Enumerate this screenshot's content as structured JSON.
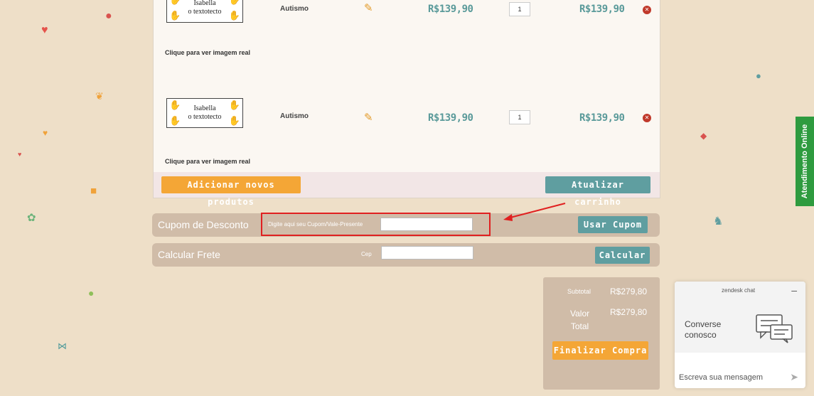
{
  "cart": {
    "items": [
      {
        "thumb_line1": "Isabella",
        "thumb_line2": "o textotecto",
        "caption": "Clique para ver imagem real",
        "name": "Autismo",
        "unit_price": "R$139,90",
        "quantity": "1",
        "total": "R$139,90"
      },
      {
        "thumb_line1": "Isabella",
        "thumb_line2": "o textotecto",
        "caption": "Clique para ver imagem real",
        "name": "Autismo",
        "unit_price": "R$139,90",
        "quantity": "1",
        "total": "R$139,90"
      }
    ],
    "add_products_label": "Adicionar novos produtos",
    "update_cart_label": "Atualizar carrinho"
  },
  "coupon": {
    "title": "Cupom de Desconto",
    "hint": "Digite aqui seu Cupom/Vale-Presente",
    "value": "",
    "button": "Usar Cupom"
  },
  "shipping": {
    "title": "Calcular Frete",
    "cep_label": "Cep",
    "value": "",
    "button": "Calcular"
  },
  "totals": {
    "subtotal_label": "Subtotal",
    "subtotal_value": "R$279,80",
    "total_label_1": "Valor",
    "total_label_2": "Total",
    "total_value": "R$279,80",
    "checkout_button": "Finalizar Compra"
  },
  "side_tab": {
    "label": "Atendimento Online"
  },
  "chat": {
    "brand": "zendesk chat",
    "title_1": "Converse",
    "title_2": "conosco",
    "placeholder": "Escreva sua mensagem"
  },
  "colors": {
    "background": "#eedfc8",
    "orange_button": "#f4a636",
    "teal_button": "#5f9ea0",
    "bar": "#d0bca8",
    "highlight": "#e02020",
    "side_tab": "#2e9b3f"
  },
  "icons": [
    "pencil-icon",
    "remove-icon",
    "hand-icon",
    "chat-bubble-icon",
    "send-icon",
    "minimize-icon"
  ]
}
